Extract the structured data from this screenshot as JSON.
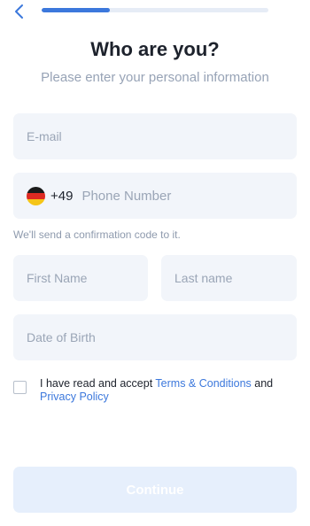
{
  "header": {
    "back_icon": "chevron-left-icon",
    "progress": 0.3,
    "accent_color": "#3c78dc",
    "track_color": "#e6ecf6"
  },
  "title": "Who are you?",
  "subtitle": "Please enter your personal information",
  "form": {
    "email": {
      "value": "",
      "placeholder": "E-mail"
    },
    "phone": {
      "country_flag": "germany-flag-icon",
      "dial_code": "+49",
      "value": "",
      "placeholder": "Phone Number"
    },
    "phone_hint": "We'll send a confirmation code to it.",
    "first_name": {
      "value": "",
      "placeholder": "First Name"
    },
    "last_name": {
      "value": "",
      "placeholder": "Last name"
    },
    "date_of_birth": {
      "value": "",
      "placeholder": "Date of Birth"
    },
    "consent": {
      "checked": false,
      "text_before": "I have read and accept ",
      "terms_link": "Terms & Conditions",
      "text_middle": " and ",
      "privacy_link": "Privacy Policy"
    }
  },
  "continue_button": {
    "label": "Continue",
    "enabled": false
  }
}
